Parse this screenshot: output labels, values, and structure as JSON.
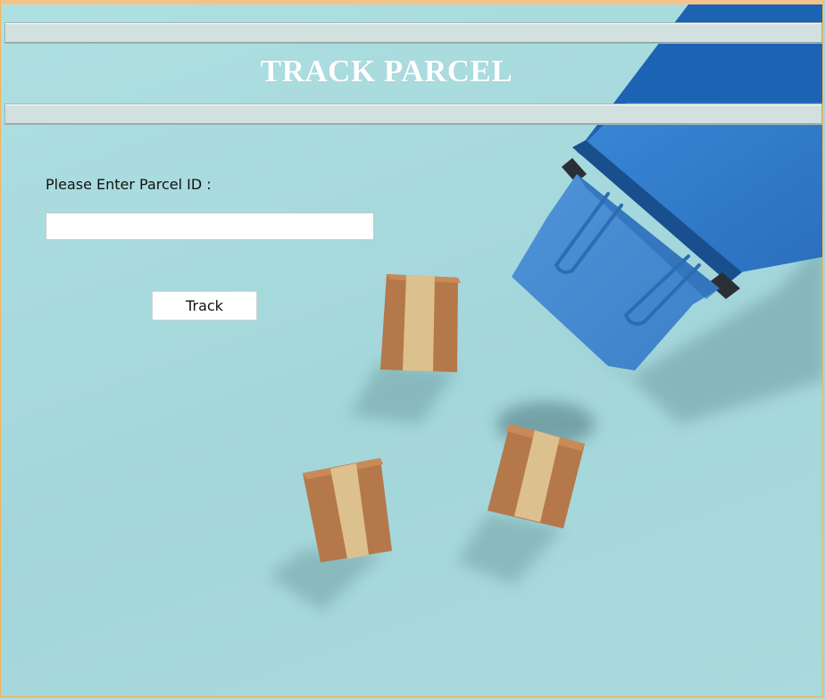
{
  "header": {
    "title": "TRACK PARCEL"
  },
  "form": {
    "label": "Please Enter Parcel ID :",
    "parcel_id_value": "",
    "parcel_id_placeholder": "",
    "track_button_label": "Track"
  },
  "colors": {
    "background": "#a8d8db",
    "header_bar": "#d2e1df",
    "title_text": "#ffffff",
    "conveyor": "#2f7fd0",
    "box": "#b77a4d",
    "tape": "#dcc08e"
  },
  "decor": {
    "background_image": "parcels-on-conveyor"
  }
}
